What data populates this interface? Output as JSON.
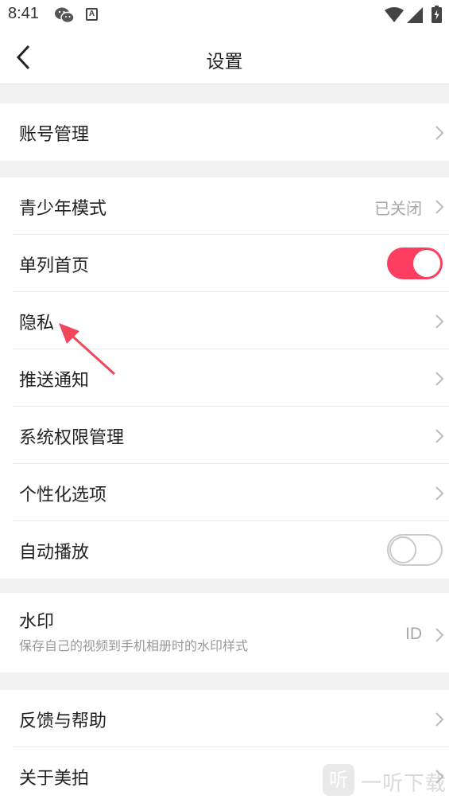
{
  "status_bar": {
    "time": "8:41"
  },
  "nav": {
    "title": "设置"
  },
  "groups": {
    "account": {
      "label": "账号管理"
    },
    "youth": {
      "label": "青少年模式",
      "value": "已关闭"
    },
    "single_column": {
      "label": "单列首页",
      "toggle": "on"
    },
    "privacy": {
      "label": "隐私"
    },
    "push": {
      "label": "推送通知"
    },
    "permissions": {
      "label": "系统权限管理"
    },
    "personalization": {
      "label": "个性化选项"
    },
    "autoplay": {
      "label": "自动播放",
      "toggle": "off"
    },
    "watermark": {
      "label": "水印",
      "sub": "保存自己的视频到手机相册时的水印样式",
      "value": "ID"
    },
    "feedback": {
      "label": "反馈与帮助"
    },
    "about": {
      "label": "关于美拍"
    }
  },
  "colors": {
    "accent": "#fd3e61",
    "annotation_arrow": "#f0475a"
  },
  "watermark_overlay": {
    "badge": "听",
    "text": "一听下载"
  }
}
